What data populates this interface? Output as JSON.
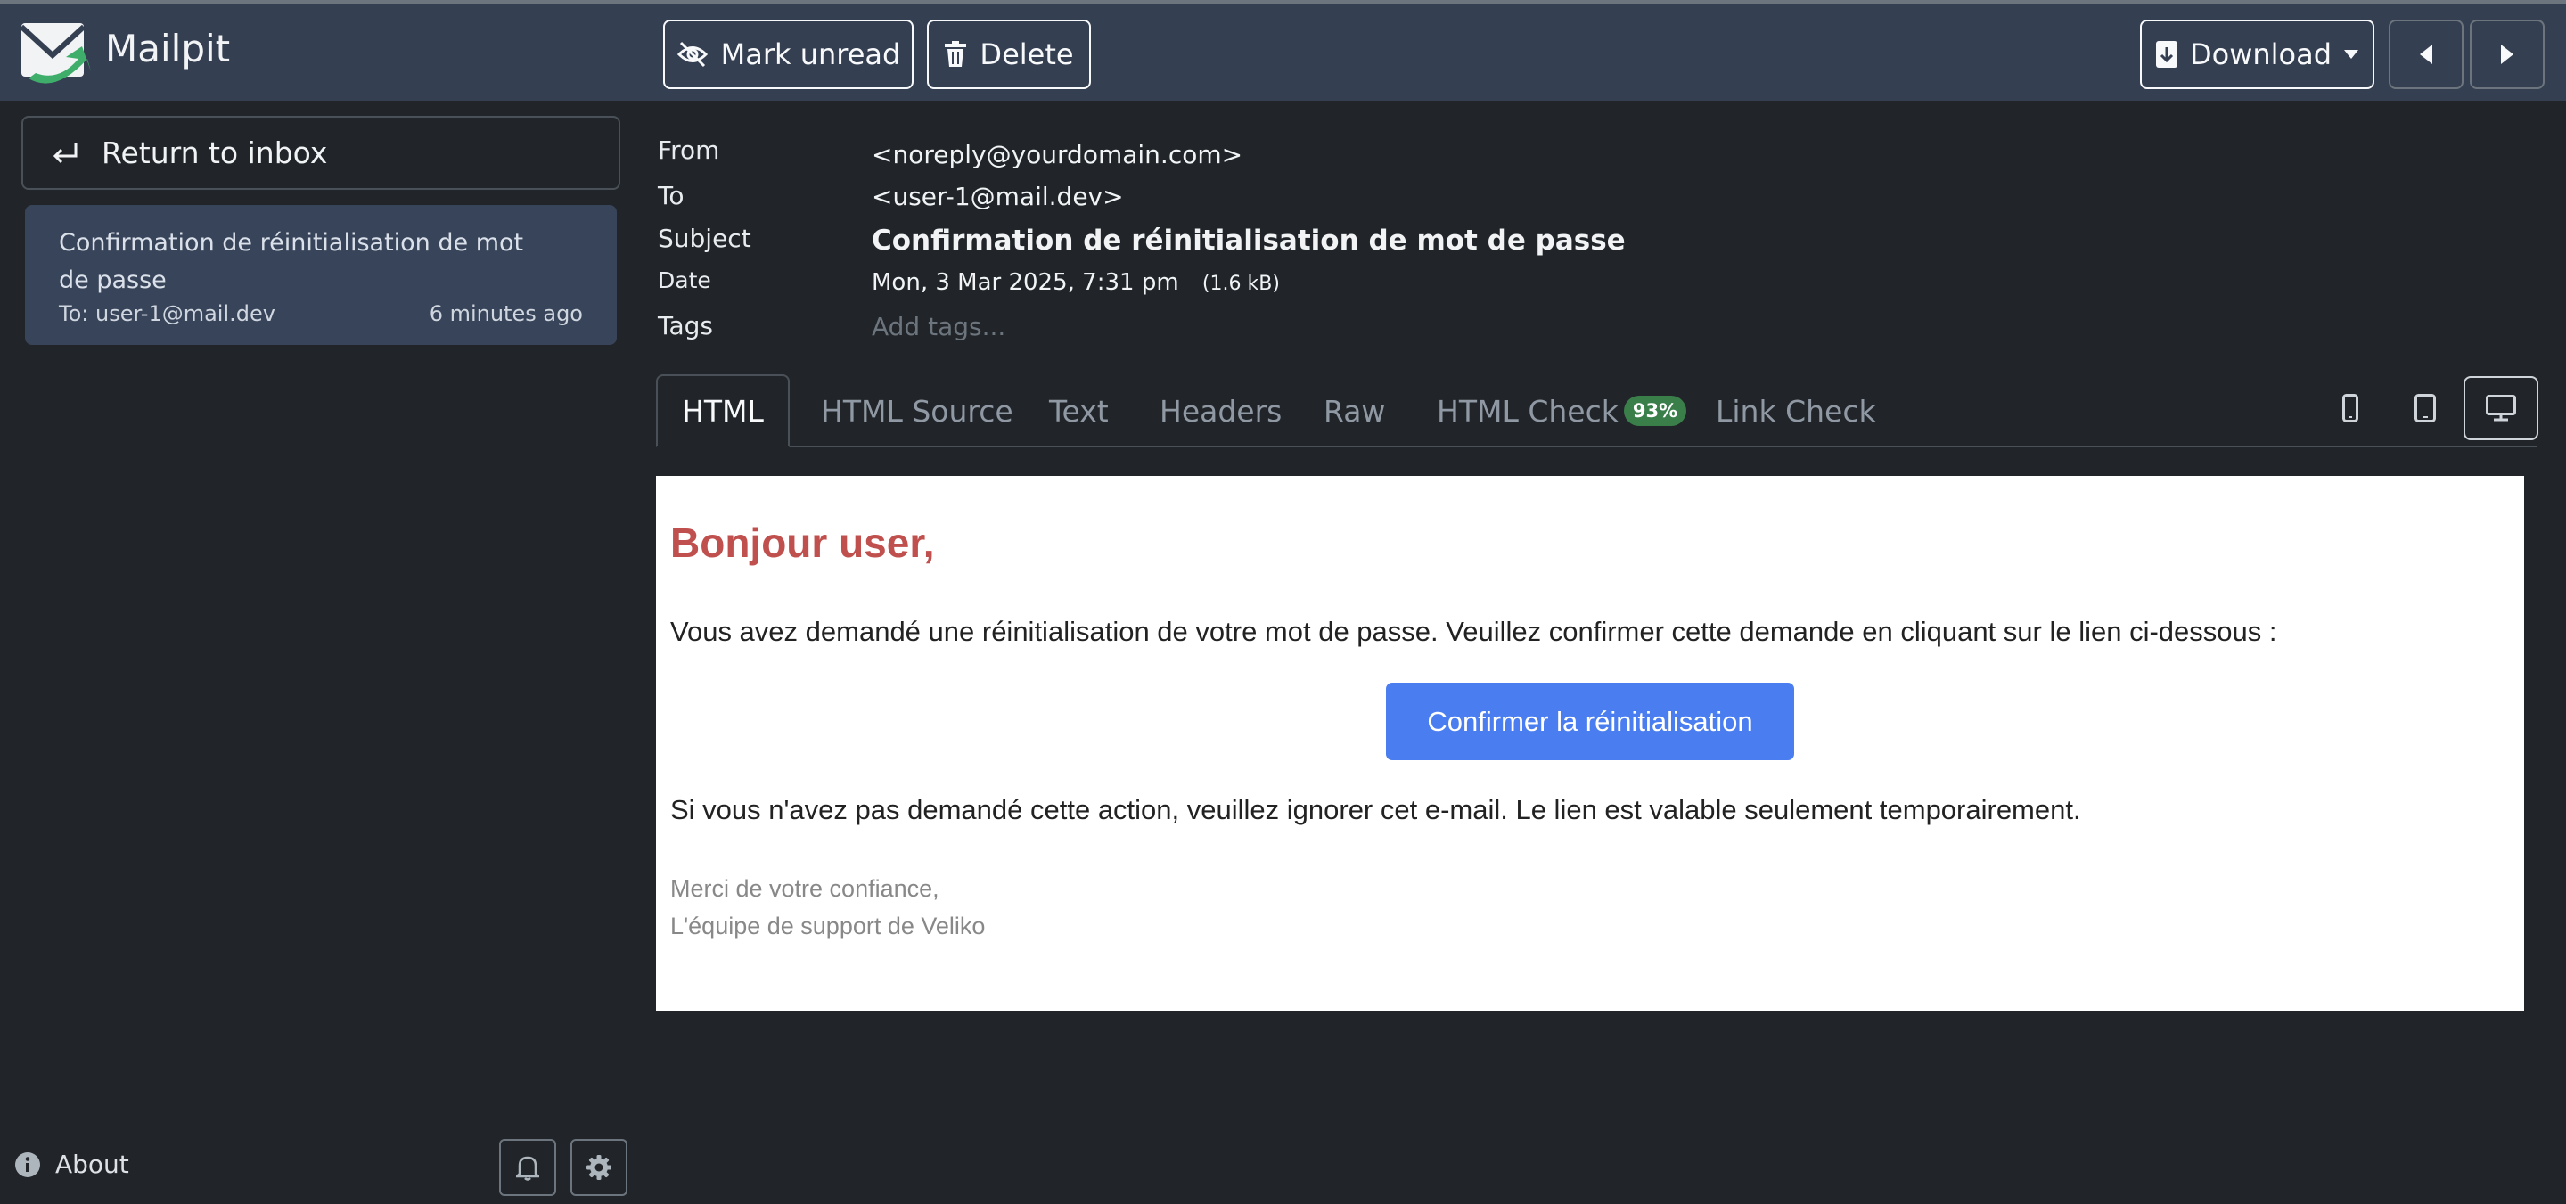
{
  "app": {
    "title": "Mailpit",
    "logo_icon": "mailpit-logo-icon"
  },
  "toolbar": {
    "mark_unread_label": "Mark unread",
    "delete_label": "Delete",
    "download_label": "Download"
  },
  "sidebar": {
    "return_label": "Return to inbox",
    "messages": [
      {
        "subject": "Confirmation de réinitialisation de mot de passe",
        "to": "To: user-1@mail.dev",
        "time": "6 minutes ago"
      }
    ],
    "about_label": "About"
  },
  "message": {
    "from_label": "From",
    "from": "<noreply@yourdomain.com>",
    "to_label": "To",
    "to": "<user-1@mail.dev>",
    "subject_label": "Subject",
    "subject": "Confirmation de réinitialisation de mot de passe",
    "date_label": "Date",
    "date": "Mon, 3 Mar 2025, 7:31 pm",
    "size": "(1.6 kB)",
    "tags_label": "Tags",
    "tags_placeholder": "Add tags..."
  },
  "tabs": {
    "html": "HTML",
    "html_source": "HTML Source",
    "text": "Text",
    "headers": "Headers",
    "raw": "Raw",
    "html_check": "HTML Check",
    "html_check_badge": "93%",
    "link_check": "Link Check"
  },
  "email": {
    "heading": "Bonjour user,",
    "paragraph1": "Vous avez demandé une réinitialisation de votre mot de passe. Veuillez confirmer cette demande en cliquant sur le lien ci-dessous :",
    "button": "Confirmer la réinitialisation",
    "paragraph2": "Si vous n'avez pas demandé cette action, veuillez ignorer cet e-mail. Le lien est valable seulement temporairement.",
    "signature1": "Merci de votre confiance,",
    "signature2": "L'équipe de support de Veliko"
  },
  "colors": {
    "navbar": "#343f52",
    "background": "#212529",
    "accent_button": "#4a7ef0",
    "heading_red": "#c0504d",
    "badge_green": "#3a7f4a"
  }
}
